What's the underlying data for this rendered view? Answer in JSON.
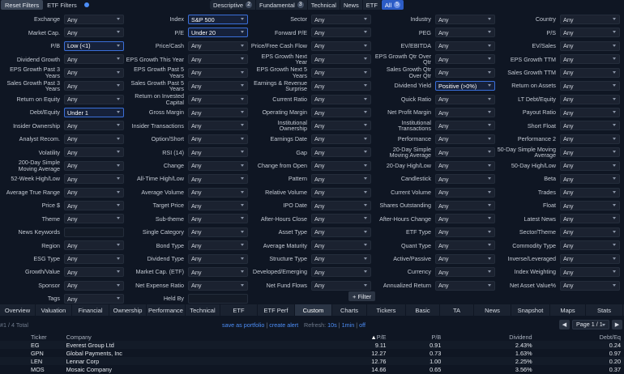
{
  "topbar": {
    "reset_label": "Reset Filters",
    "etf_filters_label": "ETF Filters",
    "tabs": [
      {
        "label": "Descriptive",
        "count": "2"
      },
      {
        "label": "Fundamental",
        "count": "3"
      },
      {
        "label": "Technical",
        "count": ""
      },
      {
        "label": "News",
        "count": ""
      },
      {
        "label": "ETF",
        "count": ""
      },
      {
        "label": "All",
        "count": "5"
      }
    ]
  },
  "filters": [
    [
      {
        "label": "Exchange",
        "value": "Any"
      },
      {
        "label": "Index",
        "value": "S&P 500",
        "on": true
      },
      {
        "label": "Sector",
        "value": "Any"
      },
      {
        "label": "Industry",
        "value": "Any"
      },
      {
        "label": "Country",
        "value": "Any"
      }
    ],
    [
      {
        "label": "Market Cap.",
        "value": "Any"
      },
      {
        "label": "P/E",
        "value": "Under 20",
        "on": true
      },
      {
        "label": "Forward P/E",
        "value": "Any"
      },
      {
        "label": "PEG",
        "value": "Any"
      },
      {
        "label": "P/S",
        "value": "Any"
      }
    ],
    [
      {
        "label": "P/B",
        "value": "Low (<1)",
        "on": true
      },
      {
        "label": "Price/Cash",
        "value": "Any"
      },
      {
        "label": "Price/Free Cash Flow",
        "value": "Any"
      },
      {
        "label": "EV/EBITDA",
        "value": "Any"
      },
      {
        "label": "EV/Sales",
        "value": "Any"
      }
    ],
    [
      {
        "label": "Dividend Growth",
        "value": "Any"
      },
      {
        "label": "EPS Growth This Year",
        "value": "Any"
      },
      {
        "label": "EPS Growth Next Year",
        "value": "Any"
      },
      {
        "label": "EPS Growth Qtr Over Qtr",
        "value": "Any"
      },
      {
        "label": "EPS Growth TTM",
        "value": "Any"
      }
    ],
    [
      {
        "label": "EPS Growth Past 3 Years",
        "value": "Any"
      },
      {
        "label": "EPS Growth Past 5 Years",
        "value": "Any"
      },
      {
        "label": "EPS Growth Next 5 Years",
        "value": "Any"
      },
      {
        "label": "Sales Growth Qtr Over Qtr",
        "value": "Any"
      },
      {
        "label": "Sales Growth TTM",
        "value": "Any"
      }
    ],
    [
      {
        "label": "Sales Growth Past 3 Years",
        "value": "Any"
      },
      {
        "label": "Sales Growth Past 5 Years",
        "value": "Any"
      },
      {
        "label": "Earnings & Revenue Surprise",
        "value": "Any"
      },
      {
        "label": "Dividend Yield",
        "value": "Positive (>0%)",
        "on": true
      },
      {
        "label": "Return on Assets",
        "value": "Any"
      }
    ],
    [
      {
        "label": "Return on Equity",
        "value": "Any"
      },
      {
        "label": "Return on Invested Capital",
        "value": "Any"
      },
      {
        "label": "Current Ratio",
        "value": "Any"
      },
      {
        "label": "Quick Ratio",
        "value": "Any"
      },
      {
        "label": "LT Debt/Equity",
        "value": "Any"
      }
    ],
    [
      {
        "label": "Debt/Equity",
        "value": "Under 1",
        "on": true
      },
      {
        "label": "Gross Margin",
        "value": "Any"
      },
      {
        "label": "Operating Margin",
        "value": "Any"
      },
      {
        "label": "Net Profit Margin",
        "value": "Any"
      },
      {
        "label": "Payout Ratio",
        "value": "Any"
      }
    ],
    [
      {
        "label": "Insider Ownership",
        "value": "Any"
      },
      {
        "label": "Insider Transactions",
        "value": "Any"
      },
      {
        "label": "Institutional Ownership",
        "value": "Any"
      },
      {
        "label": "Institutional Transactions",
        "value": "Any"
      },
      {
        "label": "Short Float",
        "value": "Any"
      }
    ],
    [
      {
        "label": "Analyst Recom.",
        "value": "Any"
      },
      {
        "label": "Option/Short",
        "value": "Any"
      },
      {
        "label": "Earnings Date",
        "value": "Any"
      },
      {
        "label": "Performance",
        "value": "Any"
      },
      {
        "label": "Performance 2",
        "value": "Any"
      }
    ],
    [
      {
        "label": "Volatility",
        "value": "Any"
      },
      {
        "label": "RSI (14)",
        "value": "Any"
      },
      {
        "label": "Gap",
        "value": "Any"
      },
      {
        "label": "20-Day Simple Moving Average",
        "value": "Any"
      },
      {
        "label": "50-Day Simple Moving Average",
        "value": "Any"
      }
    ],
    [
      {
        "label": "200-Day Simple Moving Average",
        "value": "Any"
      },
      {
        "label": "Change",
        "value": "Any"
      },
      {
        "label": "Change from Open",
        "value": "Any"
      },
      {
        "label": "20-Day High/Low",
        "value": "Any"
      },
      {
        "label": "50-Day High/Low",
        "value": "Any"
      }
    ],
    [
      {
        "label": "52-Week High/Low",
        "value": "Any"
      },
      {
        "label": "All-Time High/Low",
        "value": "Any"
      },
      {
        "label": "Pattern",
        "value": "Any"
      },
      {
        "label": "Candlestick",
        "value": "Any"
      },
      {
        "label": "Beta",
        "value": "Any"
      }
    ],
    [
      {
        "label": "Average True Range",
        "value": "Any"
      },
      {
        "label": "Average Volume",
        "value": "Any"
      },
      {
        "label": "Relative Volume",
        "value": "Any"
      },
      {
        "label": "Current Volume",
        "value": "Any"
      },
      {
        "label": "Trades",
        "value": "Any"
      }
    ],
    [
      {
        "label": "Price $",
        "value": "Any"
      },
      {
        "label": "Target Price",
        "value": "Any"
      },
      {
        "label": "IPO Date",
        "value": "Any"
      },
      {
        "label": "Shares Outstanding",
        "value": "Any"
      },
      {
        "label": "Float",
        "value": "Any"
      }
    ],
    [
      {
        "label": "Theme",
        "value": "Any"
      },
      {
        "label": "Sub-theme",
        "value": "Any"
      },
      {
        "label": "After-Hours Close",
        "value": "Any"
      },
      {
        "label": "After-Hours Change",
        "value": "Any"
      },
      {
        "label": "Latest News",
        "value": "Any"
      }
    ],
    [
      {
        "label": "News Keywords",
        "value": "",
        "text": true
      },
      {
        "label": "Single Category",
        "value": "Any"
      },
      {
        "label": "Asset Type",
        "value": "Any"
      },
      {
        "label": "ETF Type",
        "value": "Any"
      },
      {
        "label": "Sector/Theme",
        "value": "Any"
      }
    ],
    [
      {
        "label": "Region",
        "value": "Any"
      },
      {
        "label": "Bond Type",
        "value": "Any"
      },
      {
        "label": "Average Maturity",
        "value": "Any"
      },
      {
        "label": "Quant Type",
        "value": "Any"
      },
      {
        "label": "Commodity Type",
        "value": "Any"
      }
    ],
    [
      {
        "label": "ESG Type",
        "value": "Any"
      },
      {
        "label": "Dividend Type",
        "value": "Any"
      },
      {
        "label": "Structure Type",
        "value": "Any"
      },
      {
        "label": "Active/Passive",
        "value": "Any"
      },
      {
        "label": "Inverse/Leveraged",
        "value": "Any"
      }
    ],
    [
      {
        "label": "Growth/Value",
        "value": "Any"
      },
      {
        "label": "Market Cap. (ETF)",
        "value": "Any"
      },
      {
        "label": "Developed/Emerging",
        "value": "Any"
      },
      {
        "label": "Currency",
        "value": "Any"
      },
      {
        "label": "Index Weighting",
        "value": "Any"
      }
    ],
    [
      {
        "label": "Sponsor",
        "value": "Any"
      },
      {
        "label": "Net Expense Ratio",
        "value": "Any"
      },
      {
        "label": "Net Fund Flows",
        "value": "Any"
      },
      {
        "label": "Annualized Return",
        "value": "Any"
      },
      {
        "label": "Net Asset Value%",
        "value": "Any"
      }
    ],
    [
      {
        "label": "Tags",
        "value": "Any"
      },
      {
        "label": "Held By",
        "value": "",
        "text": true
      }
    ]
  ],
  "add_filter_label": "+ Filter",
  "view_tabs": [
    "Overview",
    "Valuation",
    "Financial",
    "Ownership",
    "Performance",
    "Technical",
    "ETF",
    "ETF Perf",
    "Custom",
    "Charts",
    "Tickers",
    "Basic",
    "TA",
    "News",
    "Snapshot",
    "Maps",
    "Stats"
  ],
  "active_view": "Custom",
  "info": {
    "count": "#1 / 4 Total",
    "save_portfolio": "save as portfolio",
    "create_alert": "create alert",
    "refresh_label": "Refresh:",
    "refresh_10s": "10s",
    "refresh_1min": "1min",
    "refresh_off": "off",
    "page_label": "Page 1 / 1"
  },
  "table": {
    "columns": [
      "Ticker",
      "Company",
      "P/E",
      "P/B",
      "Dividend",
      "Debt/Eq"
    ],
    "sort_arrow": "▲",
    "rows": [
      {
        "ticker": "EG",
        "company": "Everest Group Ltd",
        "pe": "9.11",
        "pb": "0.91",
        "div": "2.43%",
        "de": "0.24",
        "de_neg": false
      },
      {
        "ticker": "GPN",
        "company": "Global Payments, Inc",
        "pe": "12.27",
        "pb": "0.73",
        "div": "1.63%",
        "de": "0.97",
        "de_neg": true
      },
      {
        "ticker": "LEN",
        "company": "Lennar Corp",
        "pe": "12.76",
        "pb": "1.00",
        "div": "2.25%",
        "de": "0.20",
        "de_neg": false
      },
      {
        "ticker": "MOS",
        "company": "Mosaic Company",
        "pe": "14.66",
        "pb": "0.65",
        "div": "3.56%",
        "de": "0.37",
        "de_neg": false
      }
    ]
  },
  "colors": {
    "accent": "#2c5cc5",
    "link": "#4d8ef7",
    "positive": "#3fb950",
    "negative": "#e5534b",
    "background": "#0f1623"
  }
}
